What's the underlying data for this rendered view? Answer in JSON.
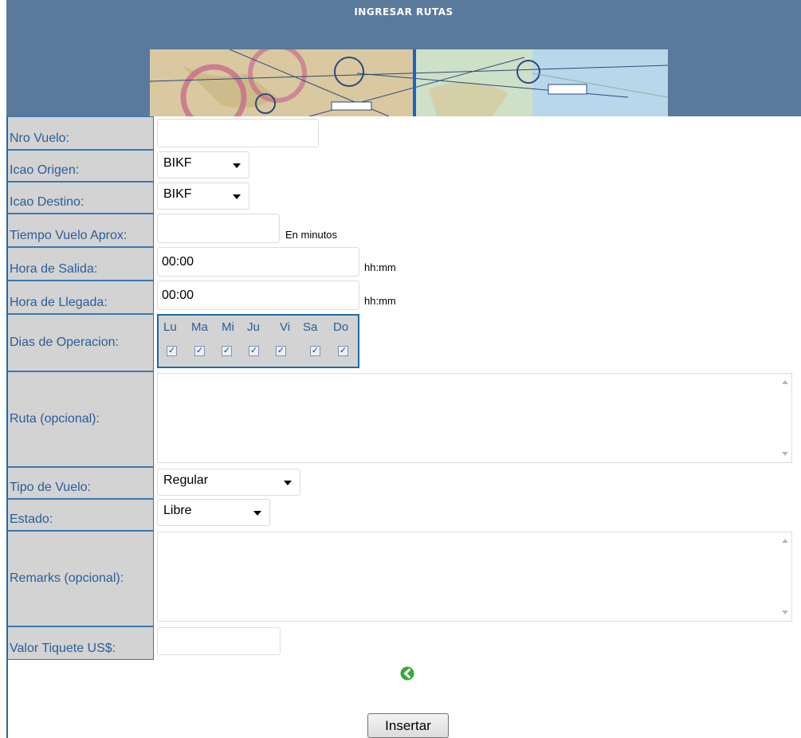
{
  "header": {
    "title": "INGRESAR RUTAS",
    "banner_image": "aeronautical-chart-map"
  },
  "form": {
    "nro_vuelo": {
      "label": "Nro Vuelo:",
      "value": ""
    },
    "icao_origen": {
      "label": "Icao Origen:",
      "value": "BIKF"
    },
    "icao_destino": {
      "label": "Icao Destino:",
      "value": "BIKF"
    },
    "tiempo_vuelo": {
      "label": "Tiempo Vuelo Aprox:",
      "value": "",
      "hint": "En minutos"
    },
    "hora_salida": {
      "label": "Hora de Salida:",
      "value": "00:00",
      "hint": "hh:mm"
    },
    "hora_llegada": {
      "label": "Hora de Llegada:",
      "value": "00:00",
      "hint": "hh:mm"
    },
    "dias": {
      "label": "Dias de Operacion:",
      "days": [
        {
          "label": "Lu",
          "checked": true
        },
        {
          "label": "Ma",
          "checked": true
        },
        {
          "label": "Mi",
          "checked": true
        },
        {
          "label": "Ju",
          "checked": true
        },
        {
          "label": "Vi",
          "checked": true
        },
        {
          "label": "Sa",
          "checked": true
        },
        {
          "label": "Do",
          "checked": true
        }
      ]
    },
    "ruta": {
      "label": "Ruta (opcional):",
      "value": ""
    },
    "tipo_vuelo": {
      "label": "Tipo de Vuelo:",
      "value": "Regular"
    },
    "estado": {
      "label": "Estado:",
      "value": "Libre"
    },
    "remarks": {
      "label": "Remarks (opcional):",
      "value": ""
    },
    "valor_tiquete": {
      "label": "Valor Tiquete US$:",
      "value": ""
    }
  },
  "back_icon": "green-circle-arrow-left-icon",
  "submit": {
    "label": "Insertar"
  },
  "colors": {
    "header_bg": "#5a7a9c",
    "label_bg": "#d3d3d3",
    "label_text": "#2a5d9a",
    "border": "#1f6aa5"
  }
}
